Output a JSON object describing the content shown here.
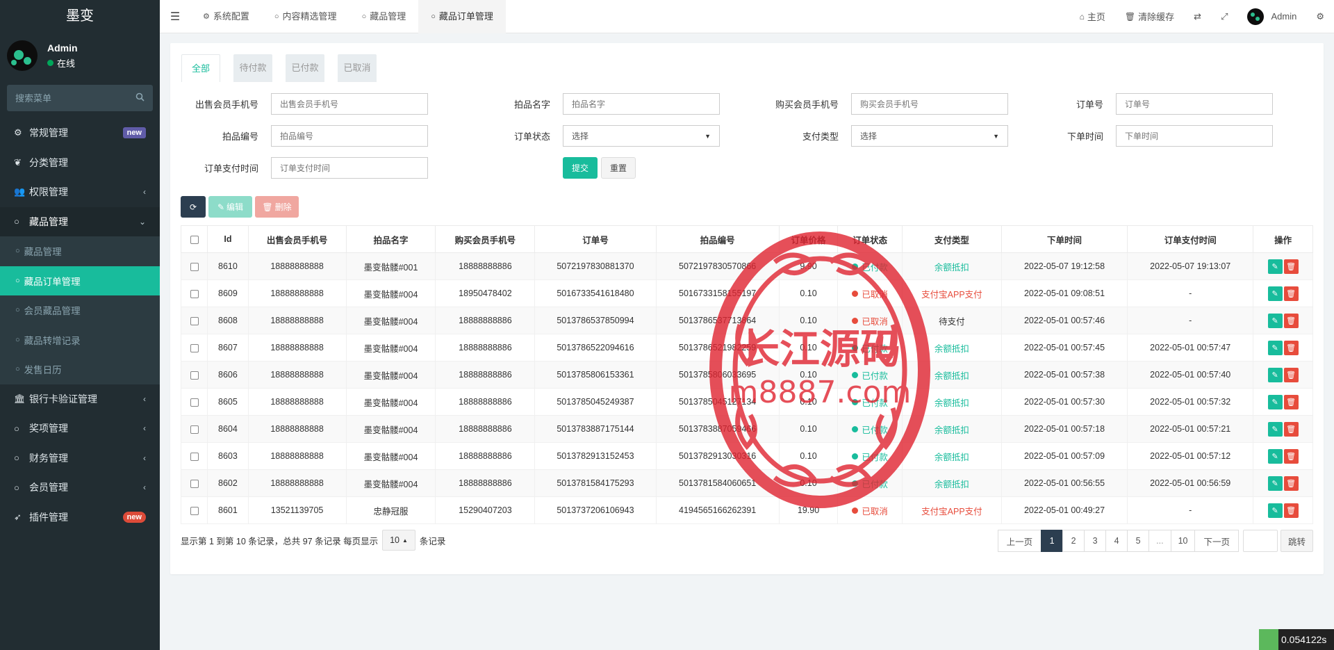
{
  "brand": "墨变",
  "user": {
    "name": "Admin",
    "status": "在线"
  },
  "search": {
    "placeholder": "搜索菜单"
  },
  "menu": [
    {
      "label": "常规管理",
      "icon": "cogs-icon",
      "badge": "new",
      "badge_color": "#605ca8"
    },
    {
      "label": "分类管理",
      "icon": "leaf-icon"
    },
    {
      "label": "权限管理",
      "icon": "group-icon",
      "arrow": "‹"
    },
    {
      "label": "藏品管理",
      "icon": "circle-icon",
      "arrow": "⌄"
    },
    {
      "label": "银行卡验证管理",
      "icon": "bank-icon",
      "arrow": "‹"
    },
    {
      "label": "奖项管理",
      "icon": "circle-icon",
      "arrow": "‹"
    },
    {
      "label": "财务管理",
      "icon": "circle-icon",
      "arrow": "‹"
    },
    {
      "label": "会员管理",
      "icon": "circle-icon",
      "arrow": "‹"
    },
    {
      "label": "插件管理",
      "icon": "rocket-icon",
      "badge": "new",
      "badge_color": "#dd4b39"
    }
  ],
  "submenu": [
    {
      "label": "藏品管理"
    },
    {
      "label": "藏品订单管理",
      "active": true
    },
    {
      "label": "会员藏品管理"
    },
    {
      "label": "藏品转增记录"
    },
    {
      "label": "发售日历"
    }
  ],
  "topnav": {
    "tabs": [
      {
        "label": "系统配置",
        "icon": "gear-icon"
      },
      {
        "label": "内容精选管理",
        "icon": "circle-icon"
      },
      {
        "label": "藏品管理",
        "icon": "circle-icon"
      },
      {
        "label": "藏品订单管理",
        "icon": "circle-icon",
        "active": true
      }
    ],
    "home": "主页",
    "clear_cache": "清除缓存",
    "admin": "Admin"
  },
  "status_tabs": [
    "全部",
    "待付款",
    "已付款",
    "已取消"
  ],
  "filters": {
    "seller_phone": {
      "label": "出售会员手机号",
      "placeholder": "出售会员手机号"
    },
    "item_name": {
      "label": "拍品名字",
      "placeholder": "拍品名字"
    },
    "buyer_phone": {
      "label": "购买会员手机号",
      "placeholder": "购买会员手机号"
    },
    "order_no": {
      "label": "订单号",
      "placeholder": "订单号"
    },
    "item_no": {
      "label": "拍品编号",
      "placeholder": "拍品编号"
    },
    "order_status": {
      "label": "订单状态",
      "value": "选择"
    },
    "pay_type": {
      "label": "支付类型",
      "value": "选择"
    },
    "order_time": {
      "label": "下单时间",
      "placeholder": "下单时间"
    },
    "pay_time": {
      "label": "订单支付时间",
      "placeholder": "订单支付时间"
    },
    "submit": "提交",
    "reset": "重置"
  },
  "toolbar": {
    "edit": "编辑",
    "delete": "删除"
  },
  "colors": {
    "accent": "#18bc9c",
    "paid": "#18bc9c",
    "cancelled": "#e74c3c",
    "danger": "#e74c3c",
    "dark": "#2c3e50",
    "sidebar": "#222d32"
  },
  "table": {
    "columns": [
      "Id",
      "出售会员手机号",
      "拍品名字",
      "购买会员手机号",
      "订单号",
      "拍品编号",
      "订单价格",
      "订单状态",
      "支付类型",
      "下单时间",
      "订单支付时间",
      "操作"
    ],
    "rows": [
      {
        "id": "8610",
        "seller": "18888888888",
        "name": "墨变骷髅#001",
        "buyer": "18888888886",
        "order_no": "5072197830881370",
        "item_no": "5072197830570866",
        "price": "9.90",
        "status": "已付款",
        "status_type": "paid",
        "pay": "余额抵扣",
        "pay_type": "balance",
        "order_time": "2022-05-07 19:12:58",
        "pay_time": "2022-05-07 19:13:07"
      },
      {
        "id": "8609",
        "seller": "18888888888",
        "name": "墨变骷髅#004",
        "buyer": "18950478402",
        "order_no": "5016733541618480",
        "item_no": "5016733158155197",
        "price": "0.10",
        "status": "已取消",
        "status_type": "cancelled",
        "pay": "支付宝APP支付",
        "pay_type": "alipay",
        "order_time": "2022-05-01 09:08:51",
        "pay_time": "-"
      },
      {
        "id": "8608",
        "seller": "18888888888",
        "name": "墨变骷髅#004",
        "buyer": "18888888886",
        "order_no": "5013786537850994",
        "item_no": "5013786537713864",
        "price": "0.10",
        "status": "已取消",
        "status_type": "cancelled",
        "pay": "待支付",
        "pay_type": "pending",
        "order_time": "2022-05-01 00:57:46",
        "pay_time": "-"
      },
      {
        "id": "8607",
        "seller": "18888888888",
        "name": "墨变骷髅#004",
        "buyer": "18888888886",
        "order_no": "5013786522094616",
        "item_no": "5013786521982259",
        "price": "0.10",
        "status": "已付款",
        "status_type": "paid",
        "pay": "余额抵扣",
        "pay_type": "balance",
        "order_time": "2022-05-01 00:57:45",
        "pay_time": "2022-05-01 00:57:47"
      },
      {
        "id": "8606",
        "seller": "18888888888",
        "name": "墨变骷髅#004",
        "buyer": "18888888886",
        "order_no": "5013785806153361",
        "item_no": "5013785806033695",
        "price": "0.10",
        "status": "已付款",
        "status_type": "paid",
        "pay": "余额抵扣",
        "pay_type": "balance",
        "order_time": "2022-05-01 00:57:38",
        "pay_time": "2022-05-01 00:57:40"
      },
      {
        "id": "8605",
        "seller": "18888888888",
        "name": "墨变骷髅#004",
        "buyer": "18888888886",
        "order_no": "5013785045249387",
        "item_no": "5013785045127134",
        "price": "0.10",
        "status": "已付款",
        "status_type": "paid",
        "pay": "余额抵扣",
        "pay_type": "balance",
        "order_time": "2022-05-01 00:57:30",
        "pay_time": "2022-05-01 00:57:32"
      },
      {
        "id": "8604",
        "seller": "18888888888",
        "name": "墨变骷髅#004",
        "buyer": "18888888886",
        "order_no": "5013783887175144",
        "item_no": "5013783887059466",
        "price": "0.10",
        "status": "已付款",
        "status_type": "paid",
        "pay": "余额抵扣",
        "pay_type": "balance",
        "order_time": "2022-05-01 00:57:18",
        "pay_time": "2022-05-01 00:57:21"
      },
      {
        "id": "8603",
        "seller": "18888888888",
        "name": "墨变骷髅#004",
        "buyer": "18888888886",
        "order_no": "5013782913152453",
        "item_no": "5013782913030316",
        "price": "0.10",
        "status": "已付款",
        "status_type": "paid",
        "pay": "余额抵扣",
        "pay_type": "balance",
        "order_time": "2022-05-01 00:57:09",
        "pay_time": "2022-05-01 00:57:12"
      },
      {
        "id": "8602",
        "seller": "18888888888",
        "name": "墨变骷髅#004",
        "buyer": "18888888886",
        "order_no": "5013781584175293",
        "item_no": "5013781584060651",
        "price": "0.10",
        "status": "已付款",
        "status_type": "paid",
        "pay": "余额抵扣",
        "pay_type": "balance",
        "order_time": "2022-05-01 00:56:55",
        "pay_time": "2022-05-01 00:56:59"
      },
      {
        "id": "8601",
        "seller": "13521139705",
        "name": "忠静冠服",
        "buyer": "15290407203",
        "order_no": "5013737206106943",
        "item_no": "4194565166262391",
        "price": "19.90",
        "status": "已取消",
        "status_type": "cancelled",
        "pay": "支付宝APP支付",
        "pay_type": "alipay",
        "order_time": "2022-05-01 00:49:27",
        "pay_time": "-"
      }
    ]
  },
  "footer": {
    "info": "显示第 1 到第 10 条记录，总共 97 条记录 每页显示",
    "page_size": "10",
    "suffix": "条记录"
  },
  "pagination": {
    "prev": "上一页",
    "pages": [
      "1",
      "2",
      "3",
      "4",
      "5",
      "...",
      "10"
    ],
    "current": "1",
    "next": "下一页",
    "jump": "跳转"
  },
  "watermark": {
    "line1": "长江源码",
    "line2": "m8887.com"
  },
  "timer": "0.054122s"
}
